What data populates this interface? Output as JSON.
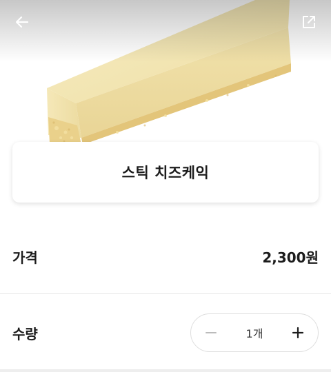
{
  "header": {
    "back_icon": "arrow-left-icon",
    "share_icon": "share-external-icon"
  },
  "product": {
    "name": "스틱 치즈케익",
    "image_subject": "stick cheesecake slice"
  },
  "price": {
    "label": "가격",
    "value": "2,300원"
  },
  "quantity": {
    "label": "수량",
    "value": "1개",
    "minus_icon": "minus-icon",
    "plus_icon": "plus-icon"
  },
  "colors": {
    "background": "#ffffff",
    "text": "#1c1c1c",
    "minus_disabled": "#bbbbbb",
    "cake_top": "#f3e7b6",
    "cake_crust": "#e8cf86"
  }
}
